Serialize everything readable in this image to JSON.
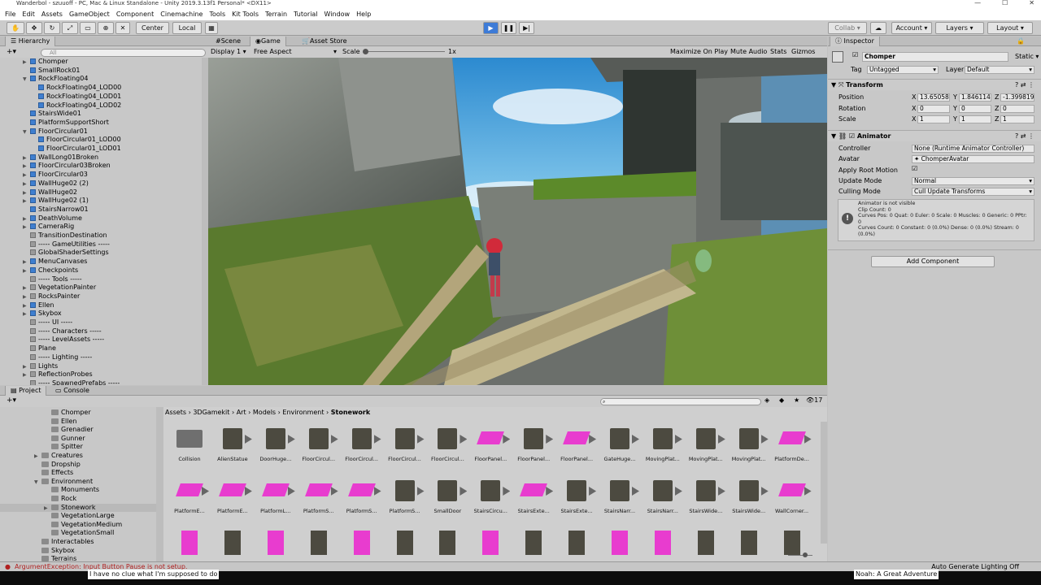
{
  "window": {
    "title": "Wanderbol - szuuoff - PC, Mac & Linux Standalone - Unity 2019.3.13f1 Personal* <DX11>"
  },
  "menu": [
    "File",
    "Edit",
    "Assets",
    "GameObject",
    "Component",
    "Cinemachine",
    "Tools",
    "Kit Tools",
    "Terrain",
    "Tutorial",
    "Window",
    "Help"
  ],
  "toolbar": {
    "center_label": "Center",
    "local_label": "Local",
    "collab_label": "Collab",
    "account_label": "Account",
    "layers_label": "Layers",
    "layout_label": "Layout"
  },
  "hierarchy": {
    "tab": "Hierarchy",
    "search_placeholder": "All",
    "items": [
      {
        "label": "Chomper",
        "indent": 1,
        "arrow": "▶",
        "color": "blue"
      },
      {
        "label": "SmallRock01",
        "indent": 1,
        "arrow": "",
        "color": "blue"
      },
      {
        "label": "RockFloating04",
        "indent": 1,
        "arrow": "▼",
        "color": "blue"
      },
      {
        "label": "RockFloating04_LOD00",
        "indent": 2,
        "arrow": "",
        "color": "blue"
      },
      {
        "label": "RockFloating04_LOD01",
        "indent": 2,
        "arrow": "",
        "color": "blue"
      },
      {
        "label": "RockFloating04_LOD02",
        "indent": 2,
        "arrow": "",
        "color": "blue"
      },
      {
        "label": "StairsWide01",
        "indent": 1,
        "arrow": "",
        "color": "blue"
      },
      {
        "label": "PlatformSupportShort",
        "indent": 1,
        "arrow": "",
        "color": "blue"
      },
      {
        "label": "FloorCircular01",
        "indent": 1,
        "arrow": "▼",
        "color": "blue"
      },
      {
        "label": "FloorCircular01_LOD00",
        "indent": 2,
        "arrow": "",
        "color": "blue"
      },
      {
        "label": "FloorCircular01_LOD01",
        "indent": 2,
        "arrow": "",
        "color": "blue"
      },
      {
        "label": "WallLong01Broken",
        "indent": 1,
        "arrow": "▶",
        "color": "blue"
      },
      {
        "label": "FloorCircular03Broken",
        "indent": 1,
        "arrow": "▶",
        "color": "blue"
      },
      {
        "label": "FloorCircular03",
        "indent": 1,
        "arrow": "▶",
        "color": "blue"
      },
      {
        "label": "WallHuge02 (2)",
        "indent": 1,
        "arrow": "▶",
        "color": "blue"
      },
      {
        "label": "WallHuge02",
        "indent": 1,
        "arrow": "▶",
        "color": "blue"
      },
      {
        "label": "WallHuge02 (1)",
        "indent": 1,
        "arrow": "▶",
        "color": "blue"
      },
      {
        "label": "StairsNarrow01",
        "indent": 1,
        "arrow": "",
        "color": "blue"
      },
      {
        "label": "DeathVolume",
        "indent": 1,
        "arrow": "▶",
        "color": "blue"
      },
      {
        "label": "CameraRig",
        "indent": 1,
        "arrow": "▶",
        "color": "blue"
      },
      {
        "label": "TransitionDestination",
        "indent": 1,
        "arrow": "",
        "color": "grey"
      },
      {
        "label": "----- GameUtilities -----",
        "indent": 1,
        "arrow": "",
        "color": "grey"
      },
      {
        "label": "GlobalShaderSettings",
        "indent": 1,
        "arrow": "",
        "color": "grey"
      },
      {
        "label": "MenuCanvases",
        "indent": 1,
        "arrow": "▶",
        "color": "blue"
      },
      {
        "label": "Checkpoints",
        "indent": 1,
        "arrow": "▶",
        "color": "blue"
      },
      {
        "label": "----- Tools -----",
        "indent": 1,
        "arrow": "",
        "color": "grey"
      },
      {
        "label": "VegetationPainter",
        "indent": 1,
        "arrow": "▶",
        "color": "grey"
      },
      {
        "label": "RocksPainter",
        "indent": 1,
        "arrow": "▶",
        "color": "grey"
      },
      {
        "label": "Ellen",
        "indent": 1,
        "arrow": "▶",
        "color": "blue"
      },
      {
        "label": "Skybox",
        "indent": 1,
        "arrow": "▶",
        "color": "blue"
      },
      {
        "label": "----- UI -----",
        "indent": 1,
        "arrow": "",
        "color": "grey"
      },
      {
        "label": "----- Characters -----",
        "indent": 1,
        "arrow": "",
        "color": "grey"
      },
      {
        "label": "----- LevelAssets -----",
        "indent": 1,
        "arrow": "",
        "color": "grey"
      },
      {
        "label": "Plane",
        "indent": 1,
        "arrow": "",
        "color": "grey"
      },
      {
        "label": "----- Lighting -----",
        "indent": 1,
        "arrow": "",
        "color": "grey"
      },
      {
        "label": "Lights",
        "indent": 1,
        "arrow": "▶",
        "color": "grey"
      },
      {
        "label": "ReflectionProbes",
        "indent": 1,
        "arrow": "▶",
        "color": "grey"
      },
      {
        "label": "----- SpawnedPrefabs -----",
        "indent": 1,
        "arrow": "",
        "color": "grey"
      }
    ]
  },
  "scene_tabs": {
    "scene": "Scene",
    "game": "Game",
    "asset_store": "Asset Store"
  },
  "game_bar": {
    "display": "Display 1",
    "aspect": "Free Aspect",
    "scale_label": "Scale",
    "scale_value": "1x",
    "maximize": "Maximize On Play",
    "mute": "Mute Audio",
    "stats": "Stats",
    "gizmos": "Gizmos"
  },
  "inspector": {
    "tab": "Inspector",
    "object_name": "Chomper",
    "static_label": "Static",
    "tag_label": "Tag",
    "tag_value": "Untagged",
    "layer_label": "Layer",
    "layer_value": "Default",
    "transform": {
      "title": "Transform",
      "position_label": "Position",
      "rotation_label": "Rotation",
      "scale_label": "Scale",
      "pos_x": "13.65058",
      "pos_y": "1.846114",
      "pos_z": "-1.399819",
      "rot_x": "0",
      "rot_y": "0",
      "rot_z": "0",
      "scl_x": "1",
      "scl_y": "1",
      "scl_z": "1"
    },
    "animator": {
      "title": "Animator",
      "controller_label": "Controller",
      "controller_value": "None (Runtime Animator Controller)",
      "avatar_label": "Avatar",
      "avatar_value": "ChomperAvatar",
      "root_motion_label": "Apply Root Motion",
      "update_mode_label": "Update Mode",
      "update_mode_value": "Normal",
      "culling_label": "Culling Mode",
      "culling_value": "Cull Update Transforms",
      "info_lines": [
        "Animator is not visible",
        "Clip Count: 0",
        "Curves Pos: 0 Quat: 0 Euler: 0 Scale: 0 Muscles: 0 Generic: 0 PPtr:",
        "0",
        "Curves Count: 0 Constant: 0 (0.0%) Dense: 0 (0.0%) Stream: 0",
        "(0.0%)"
      ]
    },
    "add_component": "Add Component"
  },
  "project": {
    "tabs": [
      "Project",
      "Console"
    ],
    "count": "17",
    "breadcrumb": [
      "Assets",
      "3DGamekit",
      "Art",
      "Models",
      "Environment",
      "Stonework"
    ],
    "tree": [
      {
        "label": "Chomper",
        "indent": 3,
        "arrow": ""
      },
      {
        "label": "Ellen",
        "indent": 3,
        "arrow": ""
      },
      {
        "label": "Grenadier",
        "indent": 3,
        "arrow": ""
      },
      {
        "label": "Gunner",
        "indent": 3,
        "arrow": ""
      },
      {
        "label": "Spitter",
        "indent": 3,
        "arrow": ""
      },
      {
        "label": "Creatures",
        "indent": 2,
        "arrow": "▶"
      },
      {
        "label": "Dropship",
        "indent": 2,
        "arrow": ""
      },
      {
        "label": "Effects",
        "indent": 2,
        "arrow": ""
      },
      {
        "label": "Environment",
        "indent": 2,
        "arrow": "▼"
      },
      {
        "label": "Monuments",
        "indent": 3,
        "arrow": ""
      },
      {
        "label": "Rock",
        "indent": 3,
        "arrow": ""
      },
      {
        "label": "Stonework",
        "indent": 3,
        "arrow": "▶"
      },
      {
        "label": "VegetationLarge",
        "indent": 3,
        "arrow": ""
      },
      {
        "label": "VegetationMedium",
        "indent": 3,
        "arrow": ""
      },
      {
        "label": "VegetationSmall",
        "indent": 3,
        "arrow": ""
      },
      {
        "label": "Interactables",
        "indent": 2,
        "arrow": ""
      },
      {
        "label": "Skybox",
        "indent": 2,
        "arrow": ""
      },
      {
        "label": "Terrains",
        "indent": 2,
        "arrow": ""
      }
    ],
    "assets_row1": [
      "Collision",
      "AlienStatue",
      "DoorHuge...",
      "FloorCircul...",
      "FloorCircul...",
      "FloorCircul...",
      "FloorCircul...",
      "FloorPanel...",
      "FloorPanel...",
      "FloorPanel...",
      "GateHuge...",
      "MovingPlat...",
      "MovingPlat...",
      "MovingPlat...",
      "PlatformDe..."
    ],
    "assets_row2": [
      "PlatformE...",
      "PlatformE...",
      "PlatformL...",
      "PlatformS...",
      "PlatformS...",
      "PlatformS...",
      "SmallDoor",
      "StairsCircu...",
      "StairsExte...",
      "StairsExte...",
      "StairsNarr...",
      "StairsNarr...",
      "StairsWide...",
      "StairsWide...",
      "WallCorner..."
    ]
  },
  "status": {
    "error": "ArgumentException: Input Button Pause is not setup.",
    "lighting": "Auto Generate Lighting Off"
  },
  "overlay": {
    "left_text": "I have no clue what I'm supposed to do",
    "right_text": "Noah: A Great Adventure"
  }
}
